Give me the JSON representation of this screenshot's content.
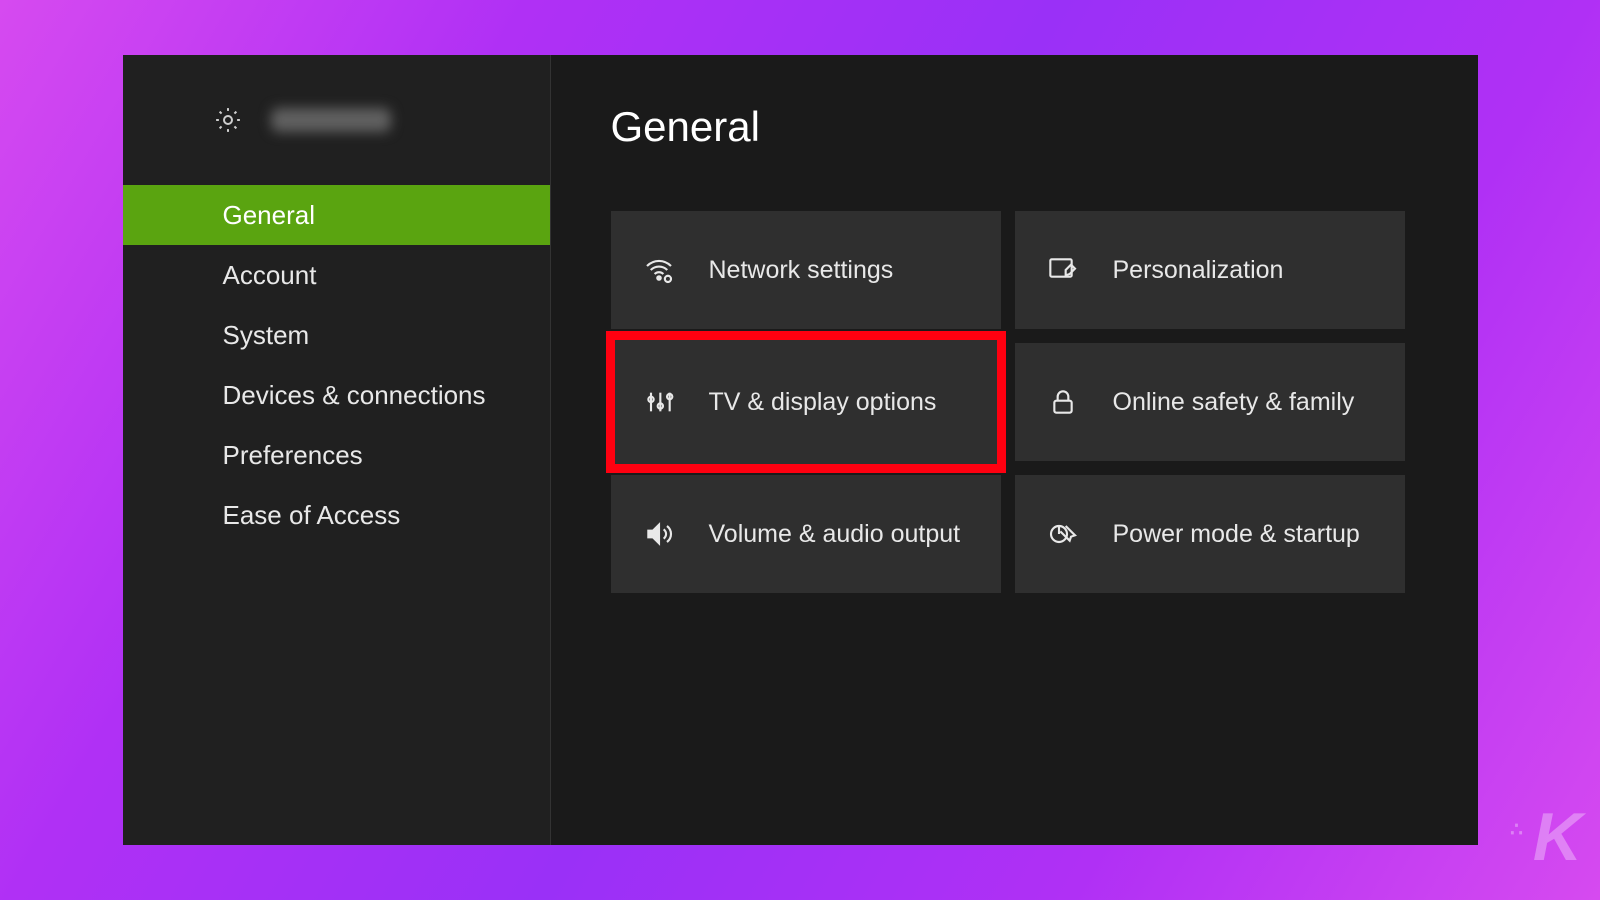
{
  "colors": {
    "accent_green": "#5aa410",
    "highlight_red": "#ff0010",
    "tile_bg": "#2f2f2f",
    "window_bg": "#1a1a1a",
    "sidebar_bg": "#202020"
  },
  "sidebar": {
    "items": [
      {
        "label": "General",
        "selected": true
      },
      {
        "label": "Account",
        "selected": false
      },
      {
        "label": "System",
        "selected": false
      },
      {
        "label": "Devices & connections",
        "selected": false
      },
      {
        "label": "Preferences",
        "selected": false
      },
      {
        "label": "Ease of Access",
        "selected": false
      }
    ]
  },
  "page": {
    "title": "General"
  },
  "tiles": [
    {
      "label": "Network settings",
      "icon": "network-icon",
      "highlight": false
    },
    {
      "label": "Personalization",
      "icon": "edit-icon",
      "highlight": false
    },
    {
      "label": "TV & display options",
      "icon": "display-icon",
      "highlight": true
    },
    {
      "label": "Online safety & family",
      "icon": "lock-icon",
      "highlight": false
    },
    {
      "label": "Volume & audio output",
      "icon": "speaker-icon",
      "highlight": false
    },
    {
      "label": "Power mode & startup",
      "icon": "power-icon",
      "highlight": false
    }
  ],
  "watermark": "K"
}
